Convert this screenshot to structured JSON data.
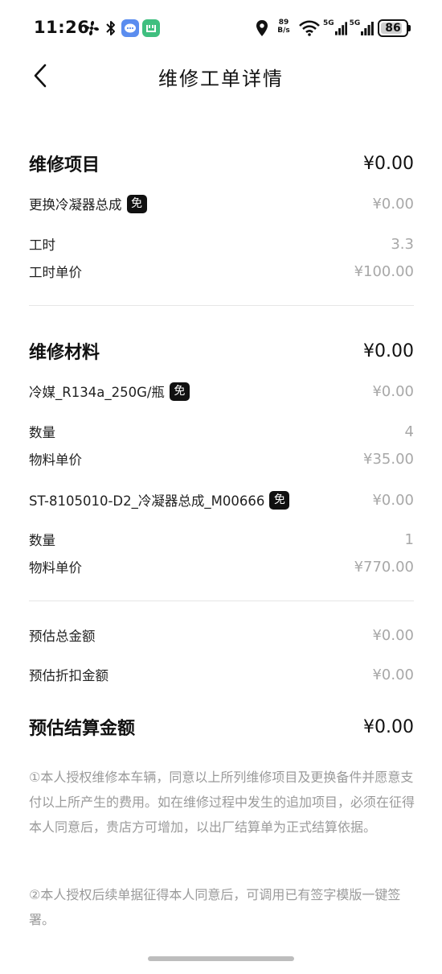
{
  "status_bar": {
    "time": "11:26",
    "net_speed_value": "89",
    "net_speed_unit": "B/s",
    "signal_1": "5G",
    "signal_2": "5G",
    "battery_level": "86"
  },
  "header": {
    "title": "维修工单详情"
  },
  "repair_items": {
    "title": "维修项目",
    "total": "¥0.00",
    "items": [
      {
        "name": "更换冷凝器总成",
        "badge": "免",
        "price": "¥0.00",
        "hours_label": "工时",
        "hours": "3.3",
        "unit_price_label": "工时单价",
        "unit_price": "¥100.00"
      }
    ]
  },
  "materials": {
    "title": "维修材料",
    "total": "¥0.00",
    "items": [
      {
        "name": "冷媒_R134a_250G/瓶",
        "badge": "免",
        "price": "¥0.00",
        "qty_label": "数量",
        "qty": "4",
        "unit_price_label": "物料单价",
        "unit_price": "¥35.00"
      },
      {
        "name": "ST-8105010-D2_冷凝器总成_M00666",
        "badge": "免",
        "price": "¥0.00",
        "qty_label": "数量",
        "qty": "1",
        "unit_price_label": "物料单价",
        "unit_price": "¥770.00"
      }
    ]
  },
  "summary": {
    "estimated_total_label": "预估总金额",
    "estimated_total": "¥0.00",
    "estimated_discount_label": "预估折扣金额",
    "estimated_discount": "¥0.00",
    "settlement_label": "预估结算金额",
    "settlement": "¥0.00"
  },
  "notes": {
    "note1": "①本人授权维修本车辆，同意以上所列维修项目及更换备件并愿意支付以上所产生的费用。如在维修过程中发生的追加项目，必须在征得本人同意后，贵店方可增加，以出厂结算单为正式结算依据。",
    "note2": "②本人授权后续单据征得本人同意后，可调用已有签字模版一键签署。"
  },
  "icons": {
    "back": "chevron-left-icon",
    "fan": "fan-icon",
    "bluetooth": "bluetooth-icon",
    "message": "message-app-icon",
    "mi_home": "mi-home-app-icon",
    "location": "location-icon",
    "wifi": "wifi-icon",
    "battery": "battery-icon"
  },
  "colors": {
    "text_primary": "#111111",
    "text_muted": "#a8a8a8",
    "badge_bg": "#111111",
    "message_icon": "#5b8def",
    "mi_home_icon": "#3fbf7f"
  }
}
